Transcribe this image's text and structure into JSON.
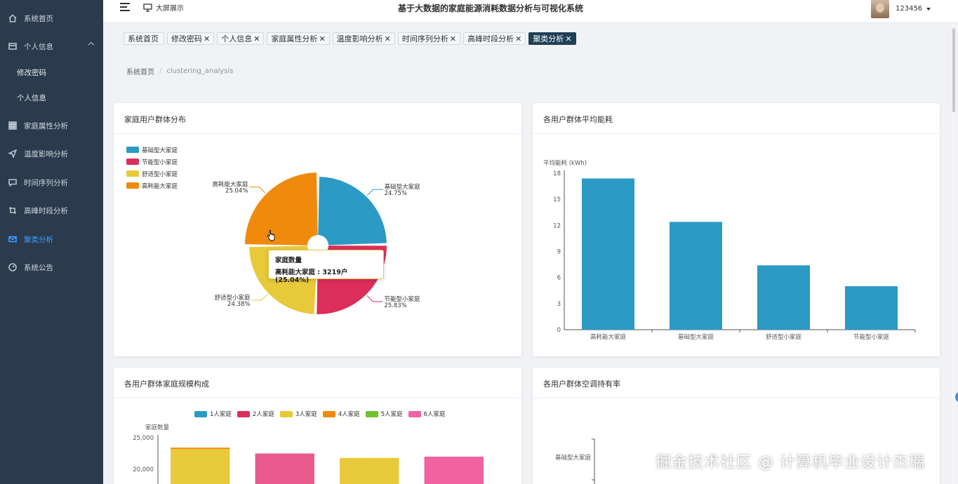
{
  "app": {
    "title": "基于大数据的家庭能源消耗数据分析与可视化系统",
    "screen_link": "大屏展示",
    "username": "123456"
  },
  "sidebar": {
    "items": [
      {
        "label": "系统首页",
        "icon": "home-icon"
      },
      {
        "label": "个人信息",
        "icon": "profile-card-icon"
      },
      {
        "label": "修改密码"
      },
      {
        "label": "个人信息"
      },
      {
        "label": "家庭属性分析",
        "icon": "grid-icon"
      },
      {
        "label": "温度影响分析",
        "icon": "send-icon"
      },
      {
        "label": "时间序列分析",
        "icon": "chat-icon"
      },
      {
        "label": "高峰时段分析",
        "icon": "crop-icon"
      },
      {
        "label": "聚类分析",
        "icon": "mail-icon"
      },
      {
        "label": "系统公告",
        "icon": "gauge-icon"
      }
    ]
  },
  "tags": [
    {
      "label": "系统首页",
      "close": ""
    },
    {
      "label": "修改密码",
      "close": "✕"
    },
    {
      "label": "个人信息",
      "close": "✕"
    },
    {
      "label": "家庭属性分析",
      "close": "✕"
    },
    {
      "label": "温度影响分析",
      "close": "✕"
    },
    {
      "label": "时间序列分析",
      "close": "✕"
    },
    {
      "label": "高峰时段分析",
      "close": "✕"
    },
    {
      "label": "聚类分析",
      "close": "✕"
    }
  ],
  "breadcrumb": {
    "home": "系统首页",
    "separator": "/",
    "current": "clustering_analysis"
  },
  "cards": {
    "pie": {
      "title": "家庭用户群体分布"
    },
    "bar": {
      "title": "各用户群体平均能耗"
    },
    "stack": {
      "title": "各用户群体家庭规模构成"
    },
    "ac": {
      "title": "各用户群体空调持有率"
    }
  },
  "tooltip": {
    "title": "家庭数量",
    "text": "高耗能大家庭 : 3219户 (25.04%)"
  },
  "watermark": "掘金技术社区 @ 计算机毕业设计杰瑞",
  "colors": {
    "blue": "#2b9ac4",
    "red": "#dc2e5a",
    "yellow": "#e8c93a",
    "orange": "#ef8a0c",
    "green": "#6fc42e",
    "pink": "#f062a0",
    "sidebar_bg": "#2b3a4c",
    "active_tag": "#1f3f57"
  },
  "chart_data": [
    {
      "type": "pie",
      "title": "家庭用户群体分布",
      "legend": [
        "基础型大家庭",
        "节能型小家庭",
        "舒适型小家庭",
        "高耗能大家庭"
      ],
      "legend_position": "top-left",
      "slices": [
        {
          "name": "基础型大家庭",
          "value": 24.75,
          "label": "24.75%",
          "color": "#2b9ac4"
        },
        {
          "name": "节能型小家庭",
          "value": 25.83,
          "label": "25.83%",
          "color": "#dc2e5a"
        },
        {
          "name": "舒适型小家庭",
          "value": 24.38,
          "label": "24.38%",
          "color": "#e8c93a"
        },
        {
          "name": "高耗能大家庭",
          "value": 25.04,
          "label": "25.04%",
          "color": "#ef8a0c"
        }
      ]
    },
    {
      "type": "bar",
      "title": "各用户群体平均能耗",
      "ylabel": "平均能耗 (kWh)",
      "categories": [
        "高耗能大家庭",
        "基础型大家庭",
        "舒适型小家庭",
        "节能型小家庭"
      ],
      "values": [
        17.4,
        12.4,
        7.4,
        5.0
      ],
      "ylim": [
        0,
        18
      ],
      "yticks": [
        0,
        3,
        6,
        9,
        12,
        15,
        18
      ],
      "color": "#2b9ac4"
    },
    {
      "type": "bar",
      "title": "各用户群体家庭规模构成",
      "ylabel": "家庭数量",
      "legend": [
        "1人家庭",
        "2人家庭",
        "3人家庭",
        "4人家庭",
        "5人家庭",
        "6人家庭"
      ],
      "legend_colors": [
        "#2b9ac4",
        "#dc2e5a",
        "#e8c93a",
        "#ef8a0c",
        "#6fc42e",
        "#f062a0"
      ],
      "yticks_visible": [
        "25,000",
        "20,000"
      ],
      "visible_tops": [
        {
          "value": 23200,
          "color": "#e8c93a"
        },
        {
          "value": 22500,
          "color": "#ea5a8c"
        },
        {
          "value": 21800,
          "color": "#e8c93a"
        },
        {
          "value": 22000,
          "color": "#f062a0"
        }
      ]
    },
    {
      "type": "bar",
      "title": "各用户群体空调持有率",
      "visible_categories": [
        "基础型大家庭"
      ]
    }
  ]
}
